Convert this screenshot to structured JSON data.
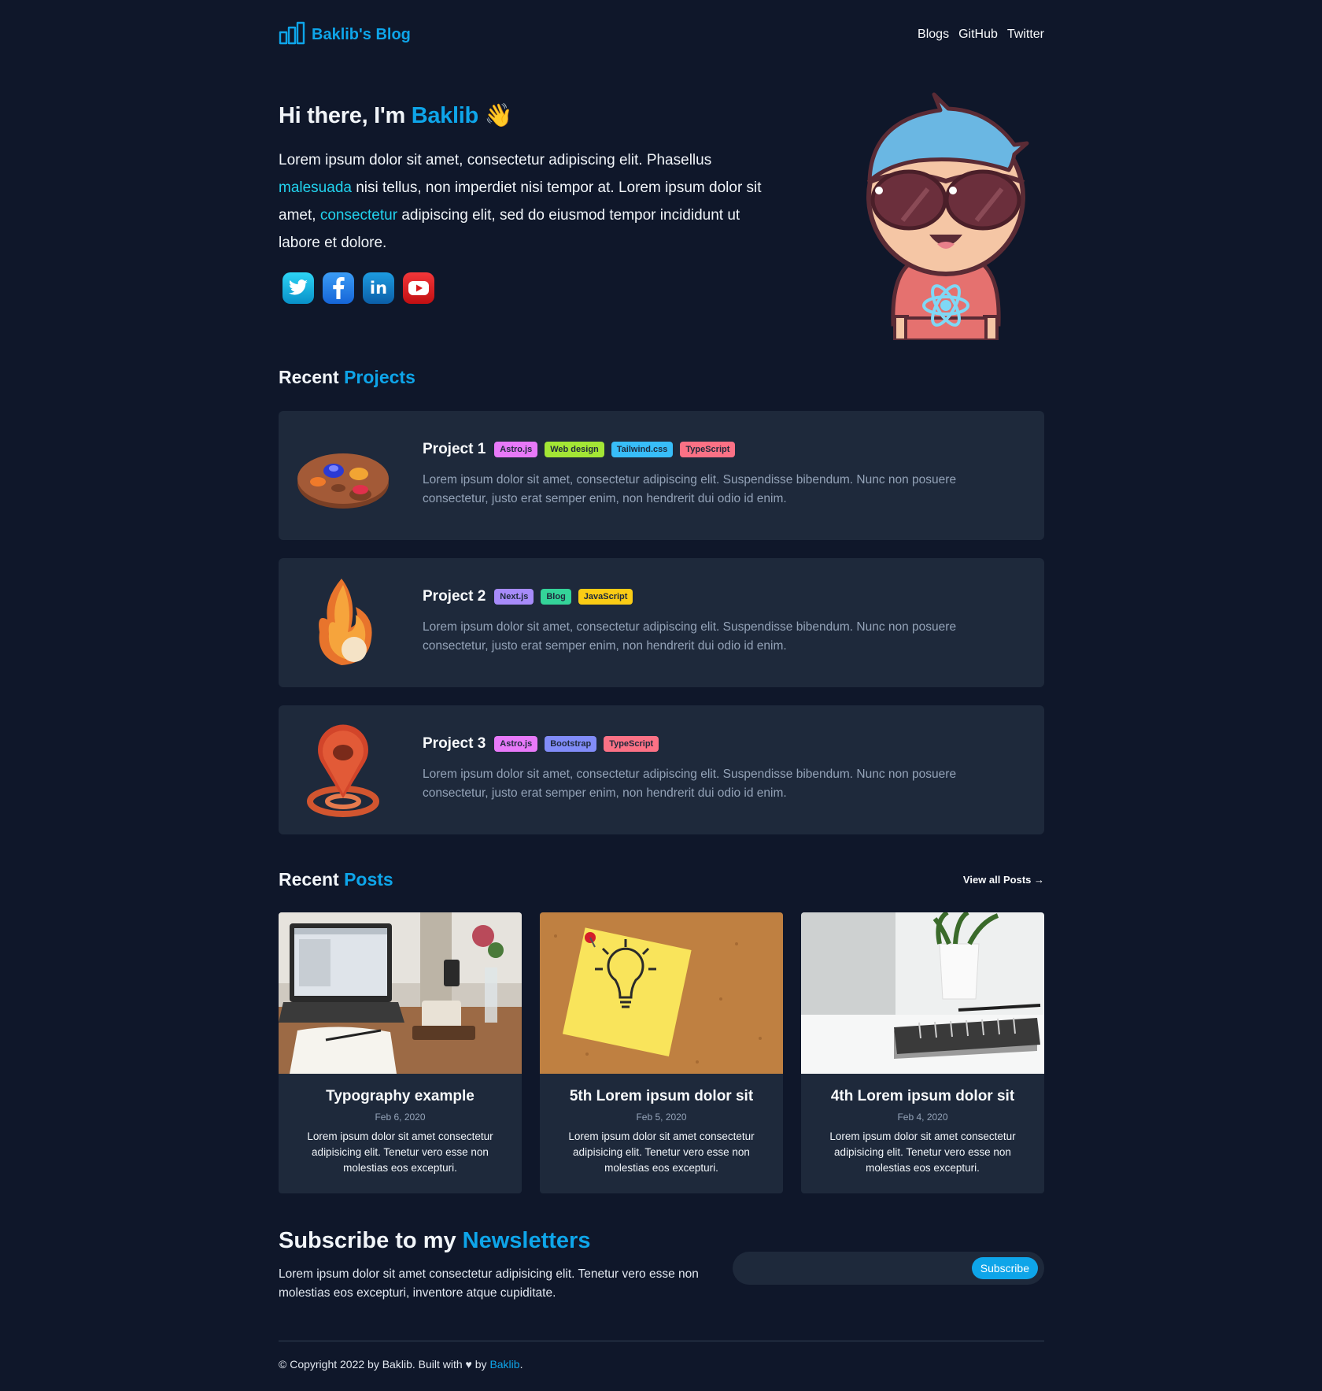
{
  "header": {
    "brand": "Baklib's Blog",
    "nav": [
      "Blogs",
      "GitHub",
      "Twitter"
    ]
  },
  "hero": {
    "greeting": "Hi there, I'm ",
    "name": "Baklib",
    "wave": "👋",
    "text_1": "Lorem ipsum dolor sit amet, consectetur adipiscing elit. Phasellus ",
    "link_1": "malesuada",
    "text_2": " nisi tellus, non imperdiet nisi tempor at. Lorem ipsum dolor sit amet, ",
    "link_2": "consectetur",
    "text_3": " adipiscing elit, sed do eiusmod tempor incididunt ut labore et dolore.",
    "socials": [
      "twitter-icon",
      "facebook-icon",
      "linkedin-icon",
      "youtube-icon"
    ]
  },
  "projects": {
    "title_1": "Recent ",
    "title_2": "Projects",
    "items": [
      {
        "title": "Project 1",
        "icon": "palette-icon",
        "tags": [
          {
            "label": "Astro.js",
            "color": "#e879f9"
          },
          {
            "label": "Web design",
            "color": "#a3e635"
          },
          {
            "label": "Tailwind.css",
            "color": "#38bdf8"
          },
          {
            "label": "TypeScript",
            "color": "#fb7185"
          }
        ],
        "desc": "Lorem ipsum dolor sit amet, consectetur adipiscing elit. Suspendisse bibendum. Nunc non posuere consectetur, justo erat semper enim, non hendrerit dui odio id enim."
      },
      {
        "title": "Project 2",
        "icon": "flame-icon",
        "tags": [
          {
            "label": "Next.js",
            "color": "#a78bfa"
          },
          {
            "label": "Blog",
            "color": "#34d399"
          },
          {
            "label": "JavaScript",
            "color": "#facc15"
          }
        ],
        "desc": "Lorem ipsum dolor sit amet, consectetur adipiscing elit. Suspendisse bibendum. Nunc non posuere consectetur, justo erat semper enim, non hendrerit dui odio id enim."
      },
      {
        "title": "Project 3",
        "icon": "location-pin-icon",
        "tags": [
          {
            "label": "Astro.js",
            "color": "#e879f9"
          },
          {
            "label": "Bootstrap",
            "color": "#818cf8"
          },
          {
            "label": "TypeScript",
            "color": "#fb7185"
          }
        ],
        "desc": "Lorem ipsum dolor sit amet, consectetur adipiscing elit. Suspendisse bibendum. Nunc non posuere consectetur, justo erat semper enim, non hendrerit dui odio id enim."
      }
    ]
  },
  "posts": {
    "title_1": "Recent ",
    "title_2": "Posts",
    "view_all": "View all Posts →",
    "items": [
      {
        "title": "Typography example",
        "date": "Feb 6, 2020",
        "excerpt": "Lorem ipsum dolor sit amet consectetur adipisicing elit. Tenetur vero esse non molestias eos excepturi."
      },
      {
        "title": "5th Lorem ipsum dolor sit",
        "date": "Feb 5, 2020",
        "excerpt": "Lorem ipsum dolor sit amet consectetur adipisicing elit. Tenetur vero esse non molestias eos excepturi."
      },
      {
        "title": "4th Lorem ipsum dolor sit",
        "date": "Feb 4, 2020",
        "excerpt": "Lorem ipsum dolor sit amet consectetur adipisicing elit. Tenetur vero esse non molestias eos excepturi."
      }
    ]
  },
  "newsletter": {
    "title_1": "Subscribe to my ",
    "title_2": "Newsletters",
    "text": "Lorem ipsum dolor sit amet consectetur adipisicing elit. Tenetur vero esse non molestias eos excepturi, inventore atque cupiditate.",
    "input_value": "",
    "button": "Subscribe"
  },
  "footer": {
    "text_1": "© Copyright 2022 by Baklib. Built with ",
    "heart": "♥",
    "text_2": " by ",
    "link": "Baklib",
    "text_3": "."
  },
  "colors": {
    "background": "#0f172a",
    "card": "#1e293b",
    "accent": "#0ea5e9"
  }
}
